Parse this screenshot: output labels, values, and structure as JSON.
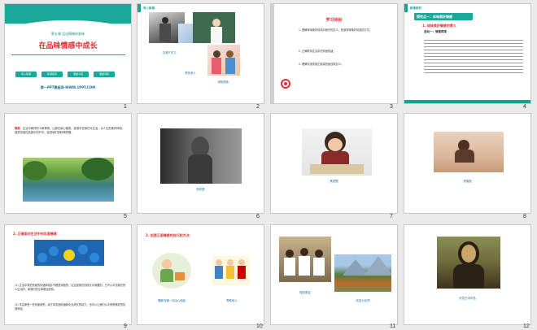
{
  "slides": [
    {
      "num": "1",
      "subtitle": "第五课 品出情感的韵味",
      "title": "在品味情感中成长",
      "chips": [
        "导入新课",
        "新课探究",
        "课堂小结",
        "课堂训练"
      ],
      "footer": "第一PPT模板网-WWW.1PPT.COM"
    },
    {
      "num": "2",
      "corner": "导入新课",
      "captions": [
        "沉浸于学习",
        "帮扶老人",
        "消除烦恼"
      ]
    },
    {
      "num": "3",
      "heading": "学习目标",
      "items": [
        "1. 理解体味美好情感对我们的意义，知道获得美好情感的方式。",
        "2. 正确看待生活中的负面情绪。",
        "3. 理解传递情感正能量的途径和意义。"
      ]
    },
    {
      "num": "4",
      "corner": "新课探究",
      "section": "探究点一：体味美好情感",
      "sub": "1. 体味美好情感的意义",
      "activity": "活动一：情景再现"
    },
    {
      "num": "5",
      "lead": "情感：",
      "text": "生活中美好的人和事物，让我们身心愉悦。逐渐丰富我们对生活、对人生的美好体验，促进情感在品德中的升华，促进我们的精神发展。"
    },
    {
      "num": "6",
      "caption": "悲伤图"
    },
    {
      "num": "7",
      "caption": "焦虑图"
    },
    {
      "num": "8",
      "caption": "烦恼图"
    },
    {
      "num": "9",
      "heading": "2. 正确面对生活中的负面情绪",
      "para1": "(1) 生活中某些负面的情绪体验并不都是消极的，往往是我们的成长中需要的。它可以丰富我们的人生阅历，使我们的生命更加深刻。",
      "para2": "(2) 学会承受一些负面感受，善于将负面情绪转化为成长的动力，也可以让我们从中获得美好的情感体验。"
    },
    {
      "num": "10",
      "heading": "3. 创造正面情感的技巧和方法：",
      "captions": [
        "理解沟通一切由心而起",
        "帮助他人"
      ]
    },
    {
      "num": "11",
      "captions": [
        "做到宽容",
        "欣赏大自然"
      ]
    },
    {
      "num": "12",
      "caption": "欣赏艺术作品"
    }
  ]
}
